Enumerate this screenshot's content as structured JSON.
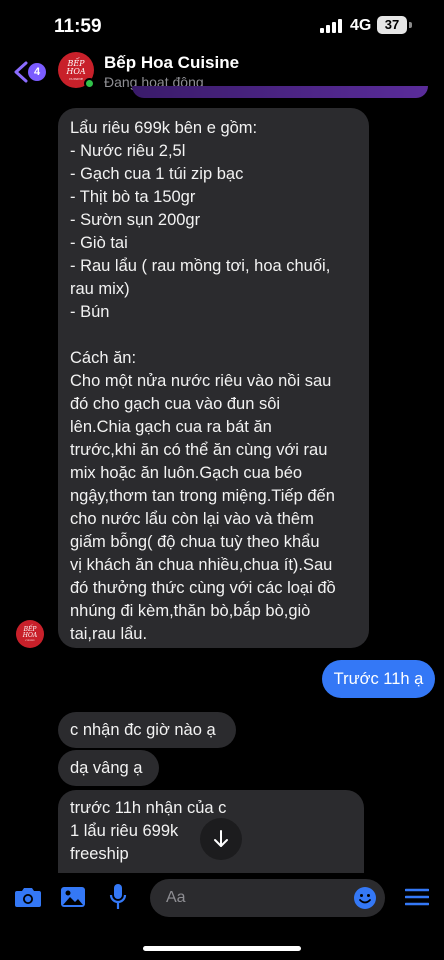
{
  "status_bar": {
    "time": "11:59",
    "network": "4G",
    "battery": "37"
  },
  "header": {
    "unread_count": "4",
    "chat_name": "Bếp Hoa Cuisine",
    "chat_status": "Đang hoạt động",
    "avatar_text": {
      "line1": "BẾP",
      "line2": "HOA",
      "line3": "CUISINE"
    }
  },
  "messages": {
    "main_lines": [
      "Lẩu riêu 699k bên e gồm:",
      "- Nước riêu 2,5l",
      "- Gạch cua 1 túi zip bạc",
      "- Thịt bò ta 150gr",
      "- Sườn sụn 200gr",
      "- Giò tai",
      "- Rau lẩu ( rau mồng tơi,  hoa chuối,",
      "rau mix)",
      "- Bún",
      "",
      "Cách ăn:",
      "Cho một nửa nước riêu vào nồi sau",
      "đó cho gạch cua vào đun sôi",
      "lên.Chia gạch cua ra bát ăn",
      "trước,khi ăn có thể ăn cùng với rau",
      "mix hoặc ăn luôn.Gạch cua béo",
      "ngậy,thơm tan trong miệng.Tiếp đến",
      "cho nước lẩu còn lại vào và thêm",
      "giấm bỗng( độ chua tuỳ theo khẩu",
      "vị khách ăn chua nhiều,chua ít).Sau",
      "đó thưởng thức cùng với các loại đồ",
      "nhúng đi kèm,thăn bò,bắp bò,giò",
      "tai,rau lẩu."
    ],
    "outgoing": "Trước 11h ạ",
    "question": "c nhận đc giờ nào ạ",
    "reply": "dạ vâng ạ",
    "last_lines": [
      "trước 11h nhận của c",
      "1 lẩu riêu 699k",
      "freeship"
    ]
  },
  "composer": {
    "placeholder": "Aa"
  },
  "colors": {
    "accent": "#3478f6",
    "incoming": "#2b2b2e",
    "brand": "#c8202a",
    "badge": "#7b5cff"
  },
  "icons": [
    "back-chevron-icon",
    "camera-icon",
    "image-icon",
    "microphone-icon",
    "emoji-icon",
    "menu-icon",
    "arrow-down-icon"
  ]
}
